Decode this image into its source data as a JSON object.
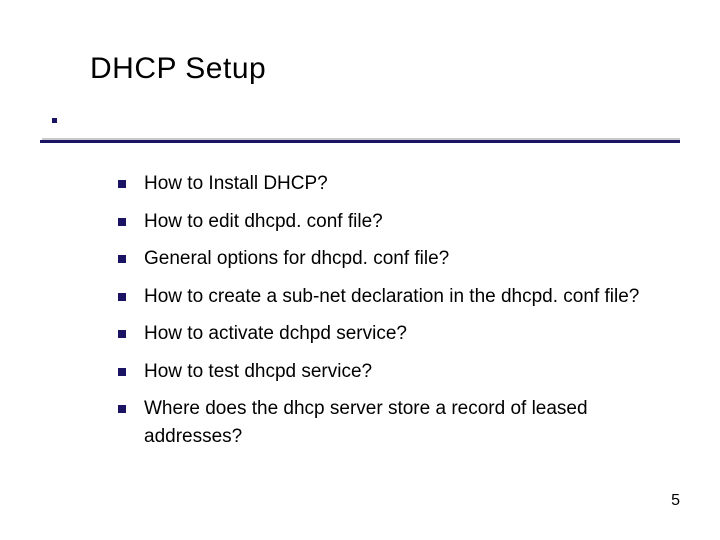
{
  "title": "DHCP Setup",
  "bullets": [
    "How to Install DHCP?",
    "How to edit dhcpd. conf file?",
    "General options for dhcpd. conf file?",
    "How to create a sub-net declaration in the dhcpd. conf file?",
    "How to activate dchpd service?",
    "How to test dhcpd service?",
    "Where does the dhcp server store a record of leased addresses?"
  ],
  "page_number": "5"
}
